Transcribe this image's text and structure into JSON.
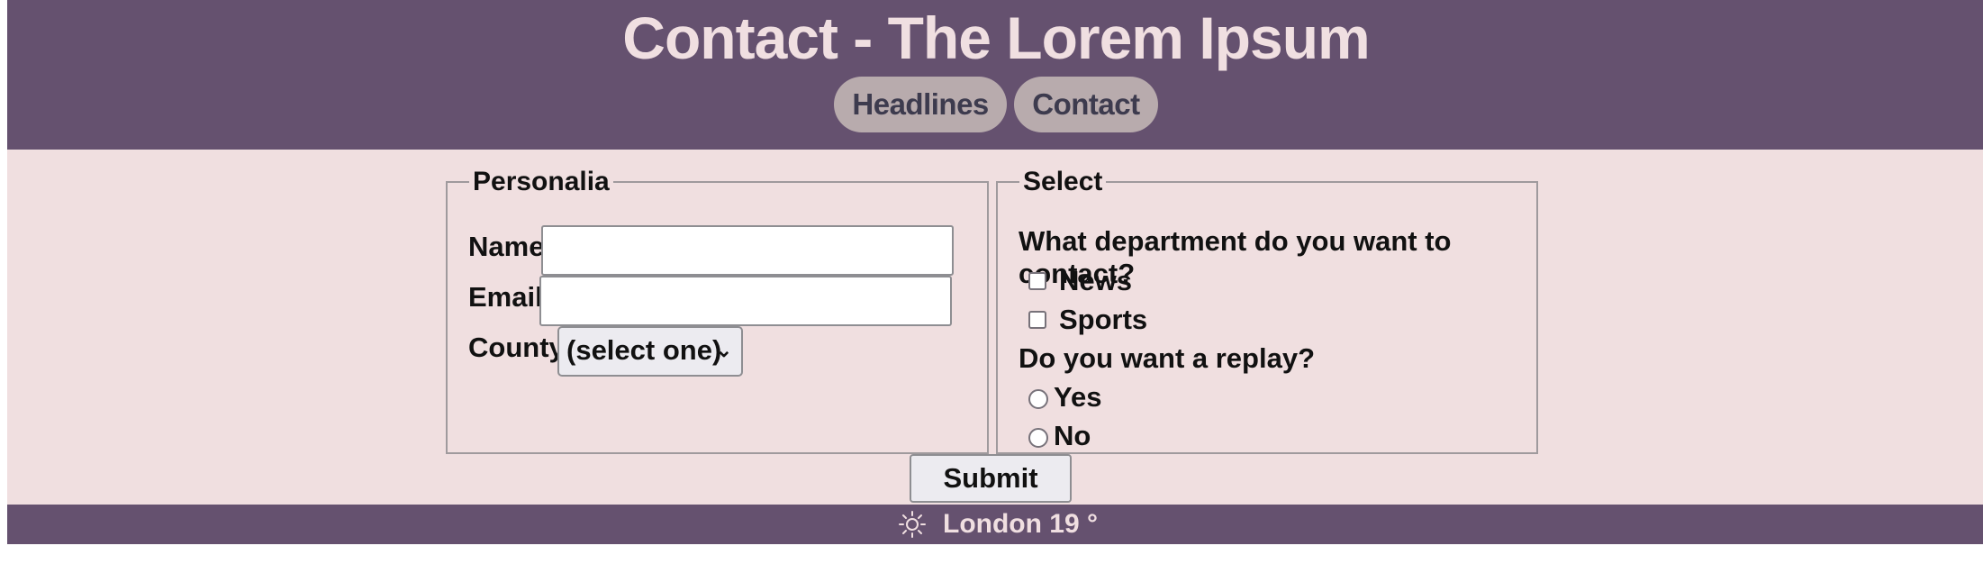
{
  "header": {
    "title": "Contact - The Lorem Ipsum",
    "nav": [
      {
        "label": "Headlines"
      },
      {
        "label": "Contact"
      }
    ]
  },
  "personalia": {
    "legend": "Personalia",
    "name_label": "Name",
    "name_value": "",
    "email_label": "Email",
    "email_value": "",
    "county_label": "County",
    "county_selected": "(select one)"
  },
  "select": {
    "legend": "Select",
    "department_question": "What department do you want to contact?",
    "departments": [
      {
        "label": "News",
        "checked": false
      },
      {
        "label": "Sports",
        "checked": false
      }
    ],
    "replay_question": "Do you want a replay?",
    "replay_options": [
      {
        "label": "Yes",
        "selected": false
      },
      {
        "label": "No",
        "selected": false
      }
    ]
  },
  "submit_label": "Submit",
  "footer": {
    "icon": "sun-icon",
    "weather_text": "London 19 °"
  },
  "colors": {
    "header_bg": "#65516f",
    "content_bg": "#f0dfe0",
    "title_text": "#f0dfe1",
    "nav_pill_bg": "#b8abad",
    "nav_pill_text": "#3d3b4e"
  }
}
